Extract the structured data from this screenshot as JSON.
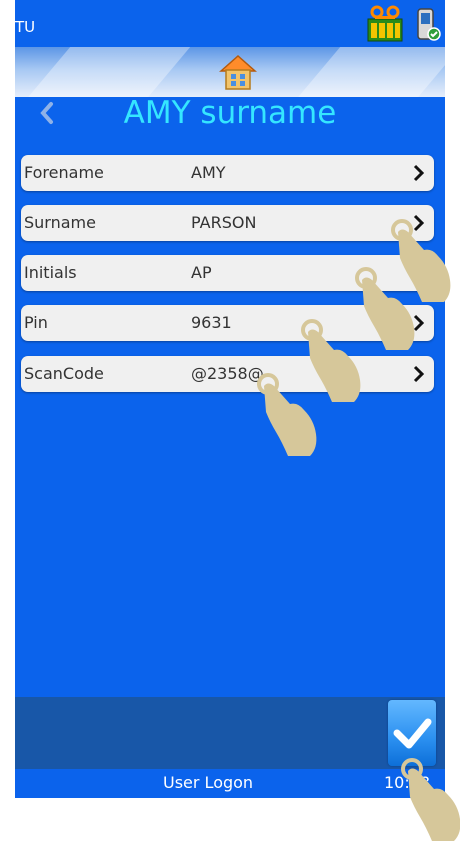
{
  "status": {
    "title": "TU"
  },
  "icons": {
    "tape": "tape-cassette-icon",
    "phone": "handset-status-icon",
    "home": "home-icon",
    "back": "chevron-left-icon",
    "ok": "checkmark-icon",
    "hand": "tap-hand-icon"
  },
  "header": {
    "title": "AMY surname"
  },
  "rows": [
    {
      "label": "Forename",
      "value": "AMY"
    },
    {
      "label": "Surname",
      "value": "PARSON"
    },
    {
      "label": "Initials",
      "value": "AP"
    },
    {
      "label": "Pin",
      "value": "9631"
    },
    {
      "label": "ScanCode",
      "value": "@2358@"
    }
  ],
  "footer": {
    "title": "User Logon",
    "time": "10:38"
  },
  "colors": {
    "background": "#0b63ec",
    "title": "#35e6ff",
    "footer": "#1857a8",
    "row": "#f0f0f0"
  }
}
